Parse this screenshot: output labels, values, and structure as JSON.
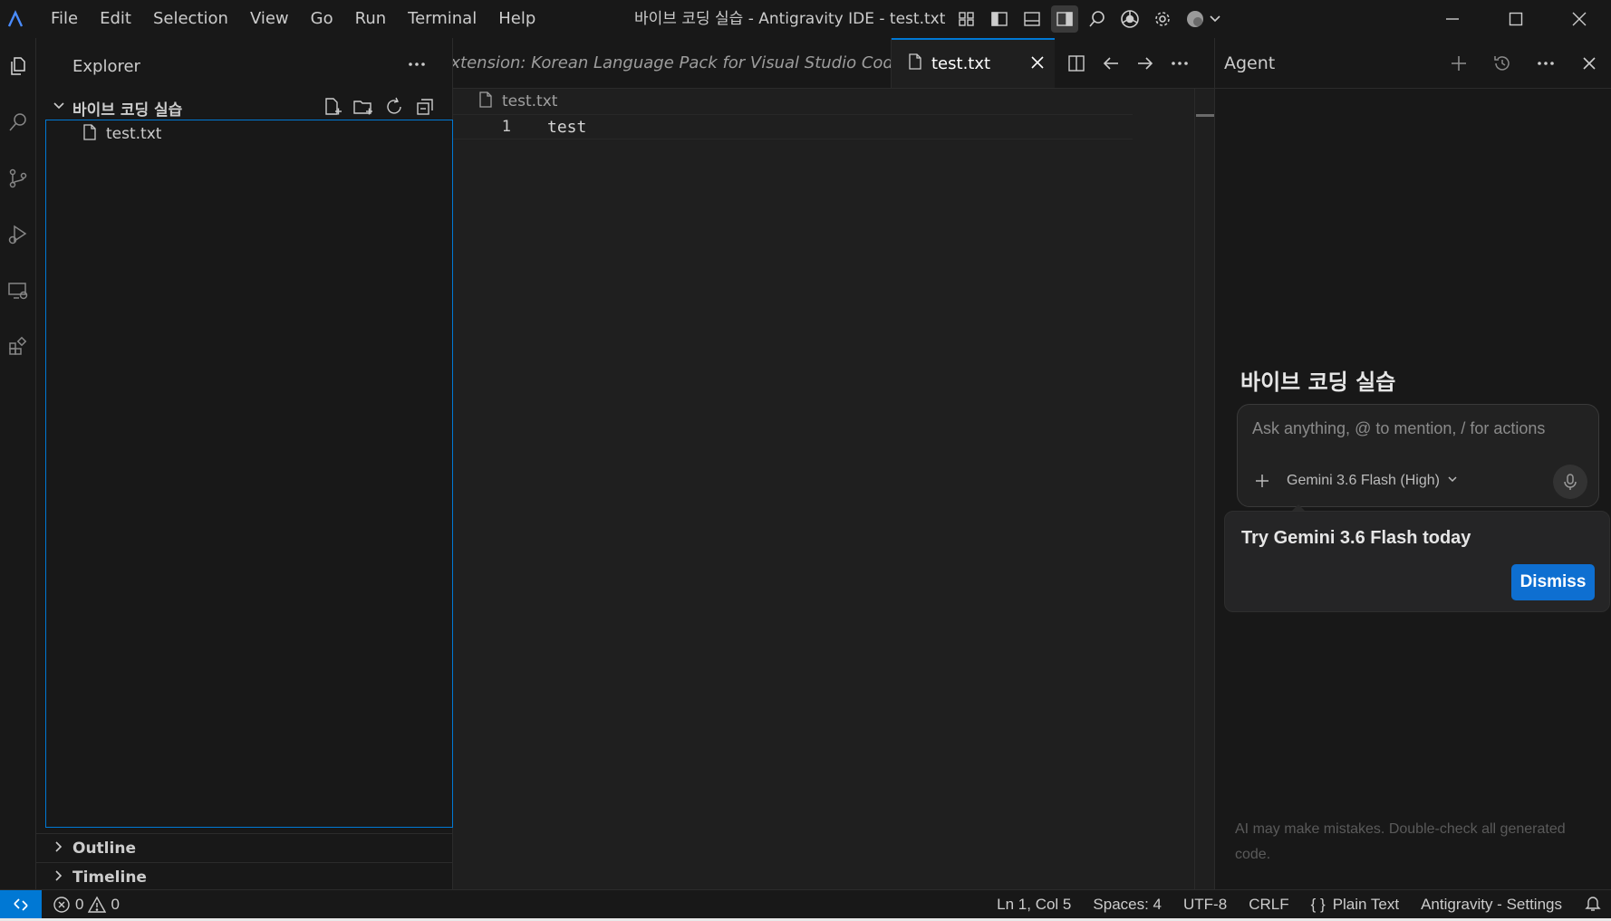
{
  "titlebar": {
    "menu": [
      "File",
      "Edit",
      "Selection",
      "View",
      "Go",
      "Run",
      "Terminal",
      "Help"
    ],
    "window_title": "바이브 코딩 실습 - Antigravity IDE - test.txt"
  },
  "sidebar": {
    "title": "Explorer",
    "folder_name": "바이브 코딩 실습",
    "files": [
      "test.txt"
    ],
    "sections": [
      "Outline",
      "Timeline"
    ]
  },
  "editor": {
    "inactive_tab_label": "Extension: Korean Language Pack for Visual Studio Code",
    "active_tab_label": "test.txt",
    "breadcrumb": "test.txt",
    "lines": [
      {
        "number": "1",
        "text": "test"
      }
    ]
  },
  "agent": {
    "title": "Agent",
    "workspace_title": "바이브 코딩 실습",
    "input_placeholder": "Ask anything, @ to mention, / for actions",
    "model": "Gemini 3.6 Flash (High)",
    "promo_text": "Try Gemini 3.6 Flash today",
    "dismiss_label": "Dismiss",
    "disclaimer": "AI may make mistakes. Double-check all generated code."
  },
  "statusbar": {
    "errors": "0",
    "warnings": "0",
    "position": "Ln 1, Col 5",
    "spaces": "Spaces: 4",
    "encoding": "UTF-8",
    "eol": "CRLF",
    "language": "Plain Text",
    "settings": "Antigravity - Settings"
  },
  "colors": {
    "accent": "#0078d4",
    "background": "#181818",
    "editor_background": "#1f1f1f",
    "dismiss_button": "#0e6fd1"
  }
}
